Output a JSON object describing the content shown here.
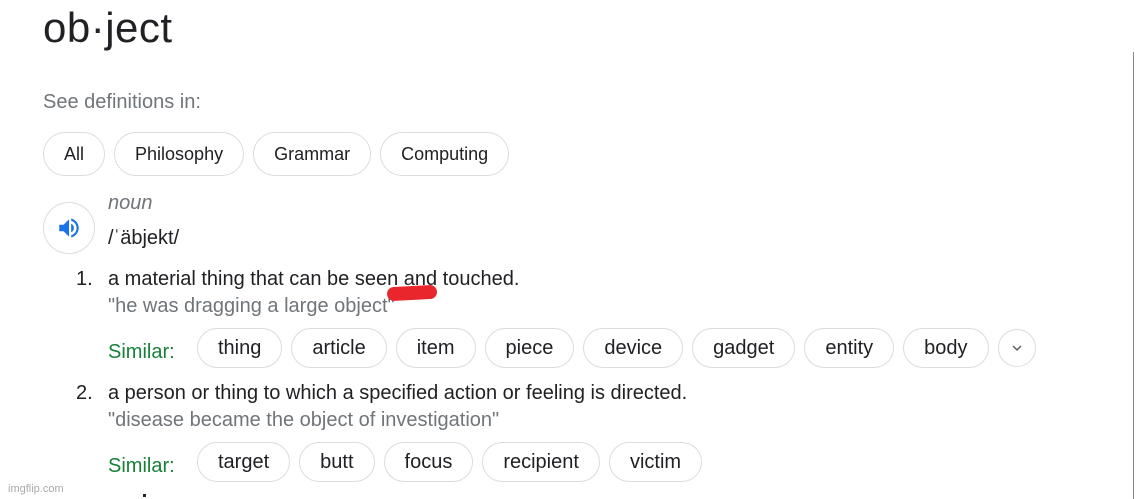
{
  "headword": "ob·ject",
  "see_definitions_label": "See definitions in:",
  "categories": [
    "All",
    "Philosophy",
    "Grammar",
    "Computing"
  ],
  "part_of_speech": "noun",
  "phonetic": "/ˈäbjekt/",
  "similar_label": "Similar:",
  "definitions": [
    {
      "number": "1.",
      "text": "a material thing that can be seen and touched.",
      "example": "\"he was dragging a large object\"",
      "similar": [
        "thing",
        "article",
        "item",
        "piece",
        "device",
        "gadget",
        "entity",
        "body"
      ]
    },
    {
      "number": "2.",
      "text": "a person or thing to which a specified action or feeling is directed.",
      "example": "\"disease became the object of investigation\"",
      "similar": [
        "target",
        "butt",
        "focus",
        "recipient",
        "victim"
      ]
    }
  ],
  "watermark": "imgflip.com",
  "icons": {
    "speaker": "speaker-icon",
    "expand": "chevron-down-icon"
  },
  "colors": {
    "similar_label": "#188038",
    "speaker_icon": "#1a73e8",
    "annotation_mark": "#e8262b"
  }
}
